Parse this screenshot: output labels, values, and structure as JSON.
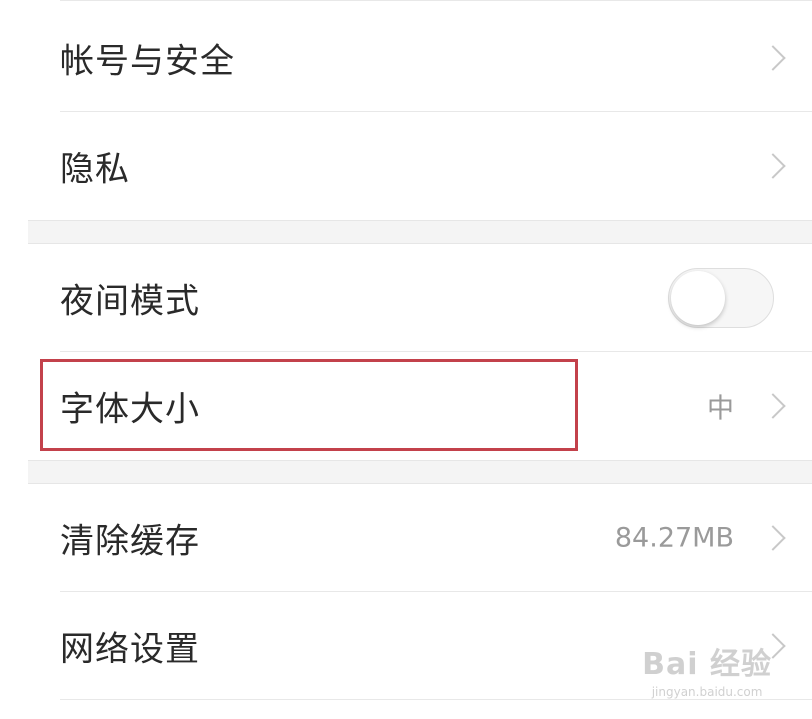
{
  "settings": {
    "group1": [
      {
        "label": "帐号与安全"
      },
      {
        "label": "隐私"
      }
    ],
    "group2": {
      "night_mode": {
        "label": "夜间模式",
        "enabled": false
      },
      "font_size": {
        "label": "字体大小",
        "value": "中"
      }
    },
    "group3": [
      {
        "label": "清除缓存",
        "value": "84.27MB"
      },
      {
        "label": "网络设置"
      }
    ]
  },
  "watermark": {
    "main": "Bai  经验",
    "sub": "jingyan.baidu.com"
  },
  "colors": {
    "highlight_border": "#c3414b",
    "section_gap": "#f4f4f4",
    "label_text": "#2a2a2a",
    "value_text": "#9a9a9a"
  }
}
